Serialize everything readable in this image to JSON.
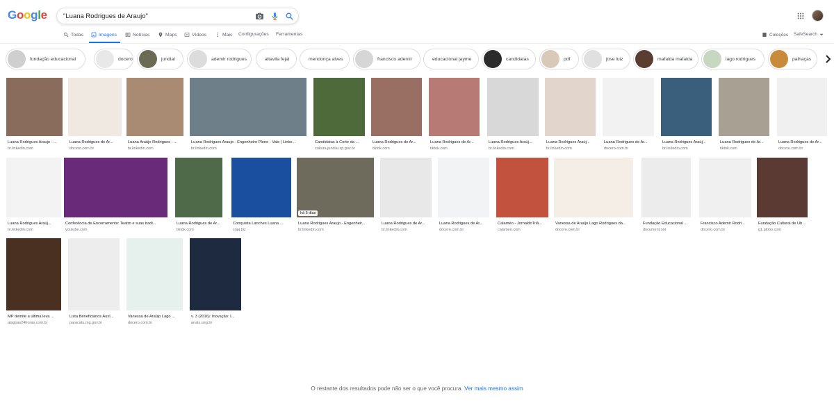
{
  "search": {
    "query": "\"Luana Rodrigues de Araujo\""
  },
  "logo": {
    "letters": [
      "G",
      "o",
      "o",
      "g",
      "l",
      "e"
    ],
    "colors": [
      "#4285f4",
      "#ea4335",
      "#fbbc05",
      "#4285f4",
      "#34a853",
      "#ea4335"
    ]
  },
  "tabs": [
    {
      "label": "Todas",
      "icon": "search-icon",
      "active": false
    },
    {
      "label": "Imagens",
      "icon": "image-icon",
      "active": true
    },
    {
      "label": "Notícias",
      "icon": "news-icon",
      "active": false
    },
    {
      "label": "Maps",
      "icon": "map-pin-icon",
      "active": false
    },
    {
      "label": "Vídeos",
      "icon": "video-icon",
      "active": false
    },
    {
      "label": "Mais",
      "icon": "more-vert-icon",
      "active": false
    },
    {
      "label": "Configurações",
      "icon": "",
      "active": false
    },
    {
      "label": "Ferramentas",
      "icon": "",
      "active": false
    }
  ],
  "right_tools": {
    "collections": "Coleções",
    "safesearch": "SafeSearch"
  },
  "chips": [
    {
      "label": "fundação educacional",
      "thumb": "#cfcfcf"
    },
    {
      "label": "docero",
      "thumb": "#e8e8e8"
    },
    {
      "label": "jundiaí",
      "thumb": "#6b6b55"
    },
    {
      "label": "ademir rodrigues",
      "thumb": "#dcdcdc"
    },
    {
      "label": "altavila fejal",
      "thumb": ""
    },
    {
      "label": "mendonça alves",
      "thumb": ""
    },
    {
      "label": "francisco ademir",
      "thumb": "#d6d6d6"
    },
    {
      "label": "educacional jayme",
      "thumb": ""
    },
    {
      "label": "candidatas",
      "thumb": "#2b2b2b"
    },
    {
      "label": "pdf",
      "thumb": "#d9c9b9"
    },
    {
      "label": "jose luiz",
      "thumb": "#e0e0e0"
    },
    {
      "label": "mafalda mafalda",
      "thumb": "#5a3d30"
    },
    {
      "label": "lago rodrigues",
      "thumb": "#c8d7c0"
    },
    {
      "label": "palhaças",
      "thumb": "#c88b3a"
    }
  ],
  "results": [
    {
      "title": "Luana Rodrigues Araujo - ...",
      "source": "br.linkedin.com",
      "color": "#8a6c5c",
      "badge": ""
    },
    {
      "title": "Luana Rodrigues de Ar...",
      "source": "docero.com.br",
      "color": "#efe9e2",
      "badge": ""
    },
    {
      "title": "Luana Araújo Rodrigues - ...",
      "source": "br.linkedin.com",
      "color": "#a88b72",
      "badge": ""
    },
    {
      "title": "Luana Rodrigues Araujo - Engenheiro Pleno - Vale | Linke...",
      "source": "br.linkedin.com",
      "color": "#6f7f8a",
      "badge": ""
    },
    {
      "title": "Candidatas à Corte da ...",
      "source": "cultura.jundiai.sp.gov.br",
      "color": "#4f6a3a",
      "badge": ""
    },
    {
      "title": "Luana Rodrigues de Ar...",
      "source": "tiktok.com",
      "color": "#9a6f63",
      "badge": ""
    },
    {
      "title": "Luana Rodrigues de Ar...",
      "source": "tiktok.com",
      "color": "#b77a74",
      "badge": ""
    },
    {
      "title": "Luana Rodrigues Araúj...",
      "source": "br.linkedin.com",
      "color": "#d8d8d8",
      "badge": ""
    },
    {
      "title": "Luana Rodrigues Araúj...",
      "source": "br.linkedin.com",
      "color": "#e2d6cc",
      "badge": ""
    },
    {
      "title": "Luana Rodrigues de Ar...",
      "source": "docero.com.br",
      "color": "#f2f2f2",
      "badge": ""
    },
    {
      "title": "Luana Rodrigues Araúj...",
      "source": "br.linkedin.com",
      "color": "#3a5f7d",
      "badge": ""
    },
    {
      "title": "Luana Rodrigues de Ar...",
      "source": "tiktok.com",
      "color": "#a8a093",
      "badge": ""
    },
    {
      "title": "Luana Rodrigues de Ar...",
      "source": "docero.com.br",
      "color": "#f0f0f0",
      "badge": ""
    },
    {
      "title": "Luana Rodrigues Araúj...",
      "source": "br.linkedin.com",
      "color": "#f3f3f3",
      "badge": ""
    },
    {
      "title": "Conferência de Encerramento: Teatro e suas tradi...",
      "source": "youtube.com",
      "color": "#6a2a7a",
      "badge": ""
    },
    {
      "title": "Luana Rodrigues de Ar...",
      "source": "tiktok.com",
      "color": "#4f6a48",
      "badge": ""
    },
    {
      "title": "Conquista Lanches Luana ...",
      "source": "cnpj.biz",
      "color": "#1a4fa0",
      "badge": ""
    },
    {
      "title": "Luana Rodrigues Araujo - Engenheir...",
      "source": "br.linkedin.com",
      "color": "#6e6a5c",
      "badge": "há 5 dias"
    },
    {
      "title": "Luana Rodrigues de Ar...",
      "source": "br.linkedin.com",
      "color": "#e8e8e8",
      "badge": ""
    },
    {
      "title": "Luana Rodrigues de Ar...",
      "source": "docero.com.br",
      "color": "#f1f3f4",
      "badge": ""
    },
    {
      "title": "Calaméo - JornaldoTriâ...",
      "source": "calameo.com",
      "color": "#c2523e",
      "badge": ""
    },
    {
      "title": "Vanessa de Araújo Lago Rodrigues da...",
      "source": "docero.com.br",
      "color": "#f4eee6",
      "badge": ""
    },
    {
      "title": "Fundação Educacional ...",
      "source": "document.onl",
      "color": "#ececec",
      "badge": ""
    },
    {
      "title": "Francisco Ademir Rodri...",
      "source": "docero.com.br",
      "color": "#f0f0f0",
      "badge": ""
    },
    {
      "title": "Fundação Cultural de Uberaba, M...",
      "source": "g1.globo.com",
      "color": "#5b3a34",
      "badge": ""
    },
    {
      "title": "MP demite a última leva ...",
      "source": "alagoas24horas.com.br",
      "color": "#4a3020",
      "badge": ""
    },
    {
      "title": "Lista Beneficiários Auxí...",
      "source": "paracatu.mg.gov.br",
      "color": "#ededed",
      "badge": ""
    },
    {
      "title": "Vanessa de Araújo Lago ...",
      "source": "docero.com.br",
      "color": "#e6f0ec",
      "badge": ""
    },
    {
      "title": "v. 3 (2016): Inovação: I...",
      "source": "anais.ueg.br",
      "color": "#1d2a3f",
      "badge": ""
    }
  ],
  "footer": {
    "text": "O restante dos resultados pode não ser o que você procura.",
    "link": "Ver mais mesmo assim"
  }
}
